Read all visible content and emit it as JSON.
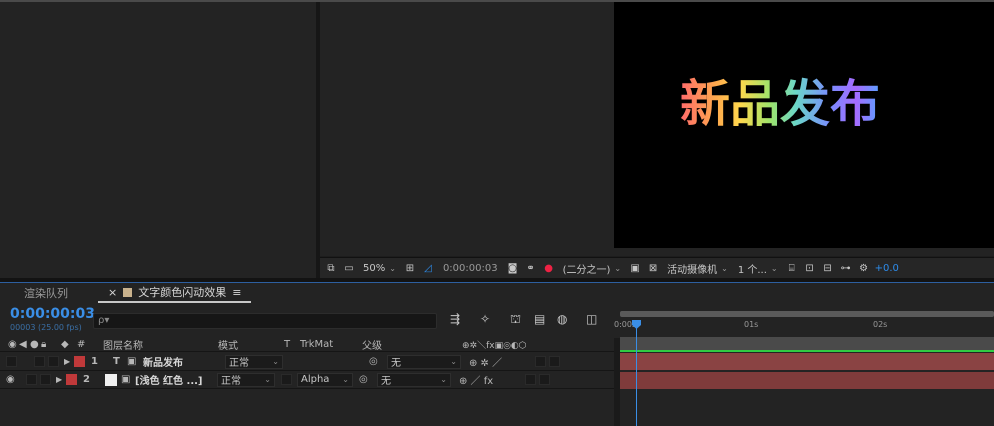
{
  "composition": {
    "preview_text": "新品发布"
  },
  "viewer_toolbar": {
    "zoom": "50%",
    "timecode": "0:00:00:03",
    "resolution": "(二分之一)",
    "camera": "活动摄像机",
    "views": "1 个...",
    "exposure": "+0.0"
  },
  "tabs": [
    {
      "label": "渲染队列"
    },
    {
      "label": "文字颜色闪动效果",
      "close": "×",
      "menu": "≡"
    }
  ],
  "timeline": {
    "current_time": "0:00:00:03",
    "fps_info": "00003 (25.00 fps)",
    "search_placeholder": "ρ▾",
    "ruler_labels": [
      "0:00s",
      "01s",
      "02s"
    ]
  },
  "columns": {
    "num": "#",
    "layer_name": "图层名称",
    "mode": "模式",
    "t": "T",
    "trkmat": "TrkMat",
    "parent": "父级",
    "switches": "⊕✲＼fx▣◎◐⬡"
  },
  "layers": [
    {
      "num": "1",
      "type": "T",
      "name": "新品发布",
      "mode": "正常",
      "trkmat": "",
      "parent": "无",
      "switches": "⊕ ✲ ／"
    },
    {
      "num": "2",
      "type": "",
      "name": "[浅色 红色 ...]",
      "mode": "正常",
      "trkmat": "Alpha",
      "parent": "无",
      "switches": "⊕  ／ fx"
    }
  ],
  "colors": {
    "accent": "#3a8ee6",
    "label": "#c0393a",
    "layer_bar": "#8a4343",
    "green": "#2fcc42"
  }
}
